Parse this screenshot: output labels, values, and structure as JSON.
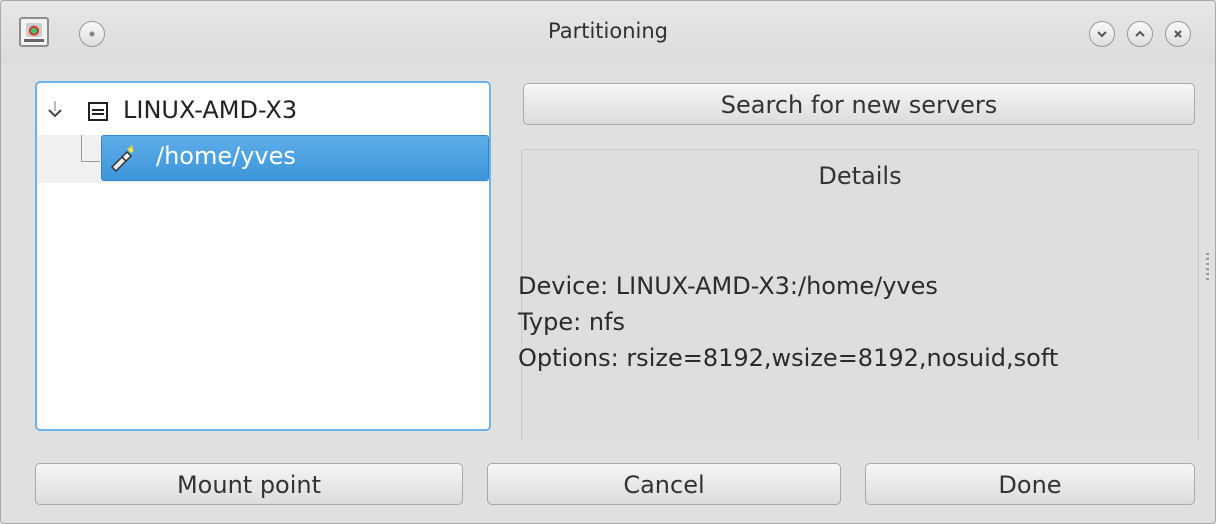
{
  "window": {
    "title": "Partitioning"
  },
  "tree": {
    "root_label": "LINUX-AMD-X3",
    "child_label": "/home/yves"
  },
  "toolbar": {
    "search_label": "Search for new servers"
  },
  "details": {
    "title": "Details",
    "device": "Device: LINUX-AMD-X3:/home/yves",
    "type": "Type: nfs",
    "options": "Options: rsize=8192,wsize=8192,nosuid,soft"
  },
  "footer": {
    "mount_point_label": "Mount point",
    "cancel_label": "Cancel",
    "done_label": "Done"
  },
  "colors": {
    "selection": "#3d95da",
    "focus_border": "#6fb3e6"
  },
  "icons": [
    "app-icon",
    "circle-icon",
    "minimize-icon",
    "maximize-icon",
    "close-icon",
    "expander-icon",
    "computer-icon",
    "nfs-share-icon"
  ]
}
